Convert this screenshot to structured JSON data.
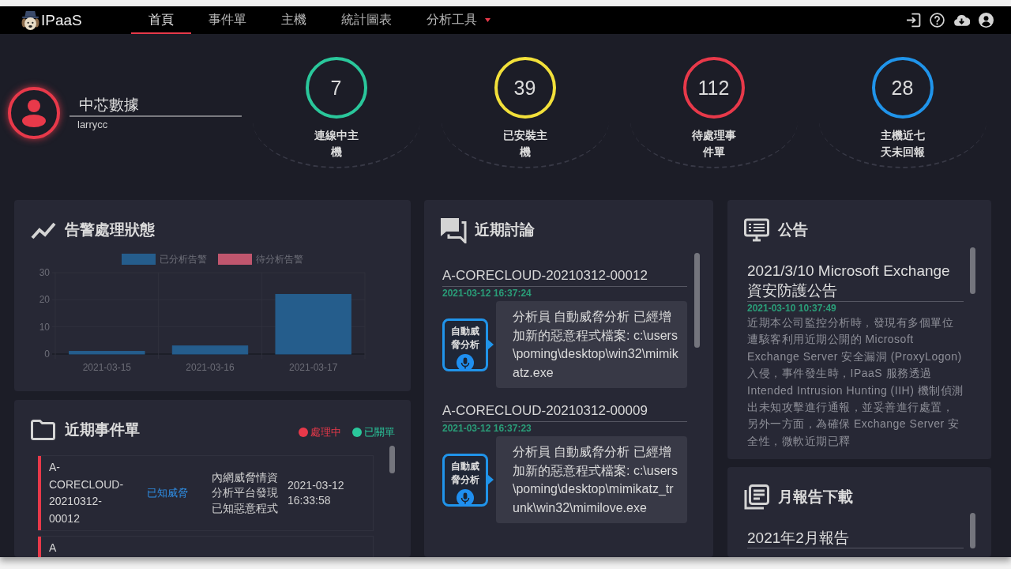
{
  "nav": {
    "logo": "IPaaS",
    "items": [
      {
        "label": "首頁",
        "selected": true,
        "dropdown": false
      },
      {
        "label": "事件單",
        "selected": false,
        "dropdown": false
      },
      {
        "label": "主機",
        "selected": false,
        "dropdown": false
      },
      {
        "label": "統計圖表",
        "selected": false,
        "dropdown": false
      },
      {
        "label": "分析工具",
        "selected": false,
        "dropdown": true
      }
    ]
  },
  "profile": {
    "name": "中芯數據",
    "username": "larrycc"
  },
  "stats": [
    {
      "value": "7",
      "label": "連線中主機",
      "color": "#2ac79b"
    },
    {
      "value": "39",
      "label": "已安裝主機",
      "color": "#f2e03a"
    },
    {
      "value": "112",
      "label": "待處理事件單",
      "color": "#e8394a"
    },
    {
      "value": "28",
      "label": "主機近七天未回報",
      "color": "#2094ea"
    }
  ],
  "alert_status": {
    "title": "告警處理狀態",
    "chart_data": {
      "type": "bar",
      "categories": [
        "2021-03-15",
        "2021-03-16",
        "2021-03-17"
      ],
      "series": [
        {
          "name": "已分析告警",
          "color": "#255d8c",
          "values": [
            1,
            3,
            22
          ]
        },
        {
          "name": "待分析告警",
          "color": "#c0566e",
          "values": [
            0,
            0,
            0
          ]
        }
      ],
      "ylim": [
        0,
        30
      ],
      "yticks": [
        0,
        10,
        20,
        30
      ],
      "stacked": true
    }
  },
  "recent_tickets": {
    "title": "近期事件單",
    "legend": [
      {
        "label": "處理中",
        "color": "#e8394a"
      },
      {
        "label": "已關單",
        "color": "#2ac79b"
      }
    ],
    "rows": [
      {
        "id": "A-CORECLOUD-20210312-00012",
        "type": "已知威脅",
        "description": "內網威脅情資分析平台發現已知惡意程式",
        "time": "2021-03-12 16:33:58",
        "color": "#e8394a"
      },
      {
        "id": "A",
        "color": "#e8394a"
      }
    ]
  },
  "recent_discussions": {
    "title": "近期討論",
    "items": [
      {
        "ticket": "A-CORECLOUD-20210312-00012",
        "time": "2021-03-12 16:37:24",
        "author": "自動威脅分析",
        "message": "分析員 自動威脅分析 已經增加新的惡意程式檔案: c:\\users\\poming\\desktop\\win32\\mimikatz.exe"
      },
      {
        "ticket": "A-CORECLOUD-20210312-00009",
        "time": "2021-03-12 16:37:23",
        "author": "自動威脅分析",
        "message": "分析員 自動威脅分析 已經增加新的惡意程式檔案: c:\\users\\poming\\desktop\\mimikatz_trunk\\win32\\mimilove.exe"
      }
    ]
  },
  "announcements": {
    "title": "公告",
    "items": [
      {
        "title": "2021/3/10 Microsoft Exchange 資安防護公告",
        "time": "2021-03-10 10:37:49",
        "body": "近期本公司監控分析時，發現有多個單位遭駭客利用近期公開的 Microsoft Exchange Server 安全漏洞 (ProxyLogon) 入侵，事件發生時，IPaaS 服務透過 Intended Intrusion Hunting (IIH) 機制偵測出未知攻擊進行通報，並妥善進行處置，另外一方面，為確保 Exchange Server 安全性，微軟近期已釋"
      }
    ]
  },
  "monthly_reports": {
    "title": "月報告下載",
    "items": [
      {
        "title": "2021年2月報告"
      }
    ]
  }
}
